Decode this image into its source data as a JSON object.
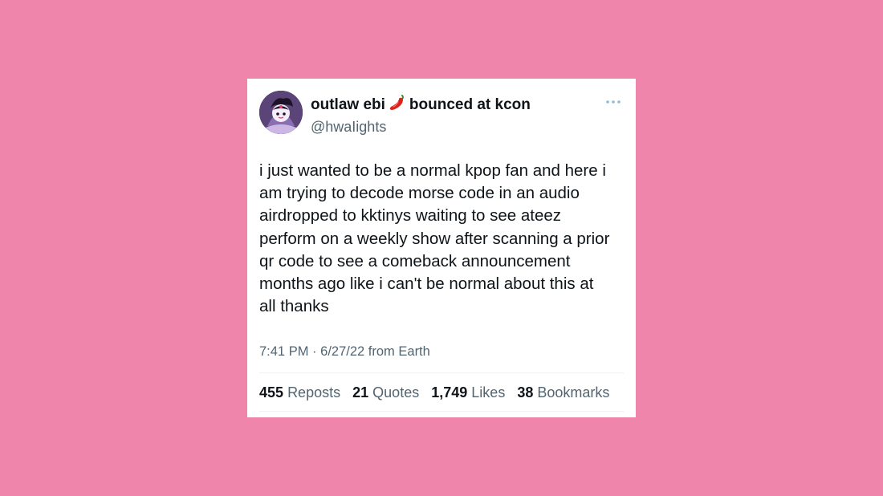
{
  "tweet": {
    "author": {
      "name_part1": "outlaw ebi",
      "name_emoji": "chili-pepper-icon",
      "name_part2": "bounced at kcon",
      "handle": "@hwaIights"
    },
    "text": "i just wanted to be a normal kpop fan and here i\nam trying to decode morse code in an audio\nairdropped to kktinys waiting to see ateez\nperform on a weekly show after scanning a prior\nqr code to see a comeback announcement\nmonths ago like i can't be normal about this at\nall thanks",
    "time": "7:41 PM",
    "separator": "·",
    "date": "6/27/22",
    "location": "from Earth",
    "stats": [
      {
        "count": "455",
        "label": "Reposts"
      },
      {
        "count": "21",
        "label": "Quotes"
      },
      {
        "count": "1,749",
        "label": "Likes"
      },
      {
        "count": "38",
        "label": "Bookmarks"
      }
    ]
  },
  "colors": {
    "background": "#ef85ab",
    "card": "#ffffff",
    "text": "#0f1419",
    "muted": "#536471",
    "more_dots": "#8bbdd9"
  }
}
